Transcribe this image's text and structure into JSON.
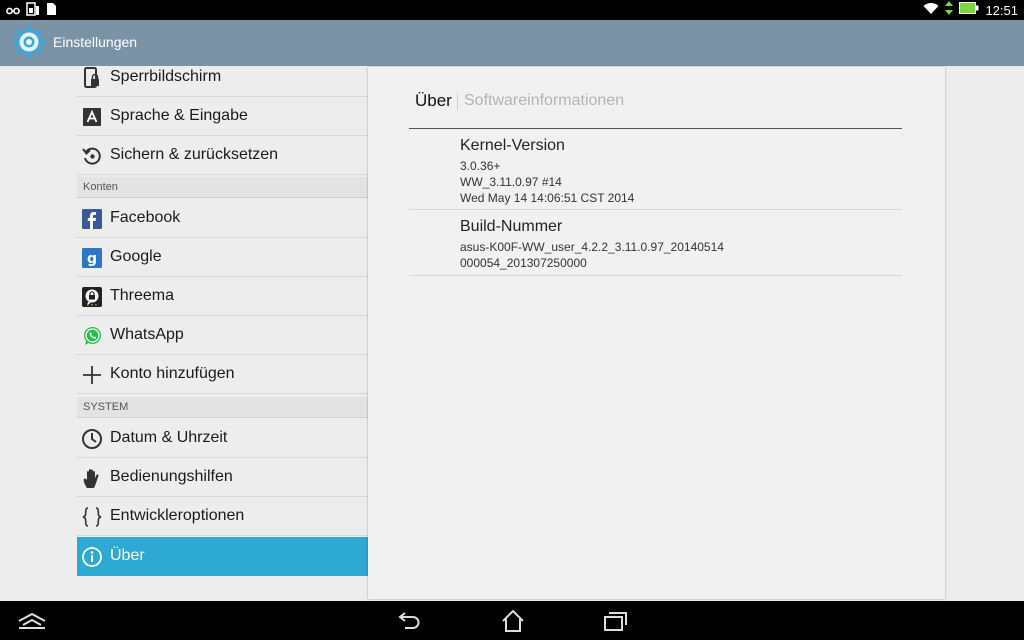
{
  "statusbar": {
    "clock": "12:51",
    "left_icons": [
      "infinity-icon",
      "sim-card-icon",
      "file-icon"
    ],
    "right_icons": [
      "wifi-icon",
      "data-arrows-icon",
      "battery-icon"
    ]
  },
  "actionbar": {
    "title": "Einstellungen",
    "icon": "gear-icon",
    "color": "#7b93a6"
  },
  "settings": {
    "items_top": [
      {
        "label": "Sperrbildschirm",
        "icon": "lock-screen-icon"
      },
      {
        "label": "Sprache & Eingabe",
        "icon": "language-icon"
      },
      {
        "label": "Sichern & zurücksetzen",
        "icon": "backup-reset-icon"
      }
    ],
    "section_konten": "Konten",
    "items_konten": [
      {
        "label": "Facebook",
        "icon": "facebook-icon"
      },
      {
        "label": "Google",
        "icon": "google-icon"
      },
      {
        "label": "Threema",
        "icon": "threema-icon"
      },
      {
        "label": "WhatsApp",
        "icon": "whatsapp-icon"
      },
      {
        "label": "Konto hinzufügen",
        "icon": "plus-icon"
      }
    ],
    "section_system": "SYSTEM",
    "items_system": [
      {
        "label": "Datum & Uhrzeit",
        "icon": "clock-icon"
      },
      {
        "label": "Bedienungshilfen",
        "icon": "hand-icon"
      },
      {
        "label": "Entwickleroptionen",
        "icon": "braces-icon"
      },
      {
        "label": "Über",
        "icon": "info-icon",
        "selected": true
      }
    ],
    "selected_color": "#2ea9d3"
  },
  "detail": {
    "breadcrumb_current": "Über",
    "breadcrumb_sub": "Softwareinformationen",
    "kernel": {
      "title": "Kernel-Version",
      "lines": [
        "3.0.36+",
        "WW_3.11.0.97 #14",
        "Wed May 14 14:06:51 CST 2014"
      ]
    },
    "build": {
      "title": "Build-Nummer",
      "lines": [
        "asus-K00F-WW_user_4.2.2_3.11.0.97_20140514",
        "000054_201307250000"
      ]
    }
  },
  "navbar": {
    "buttons": [
      "menu-up-icon",
      "back-icon",
      "home-icon",
      "recent-apps-icon"
    ]
  }
}
